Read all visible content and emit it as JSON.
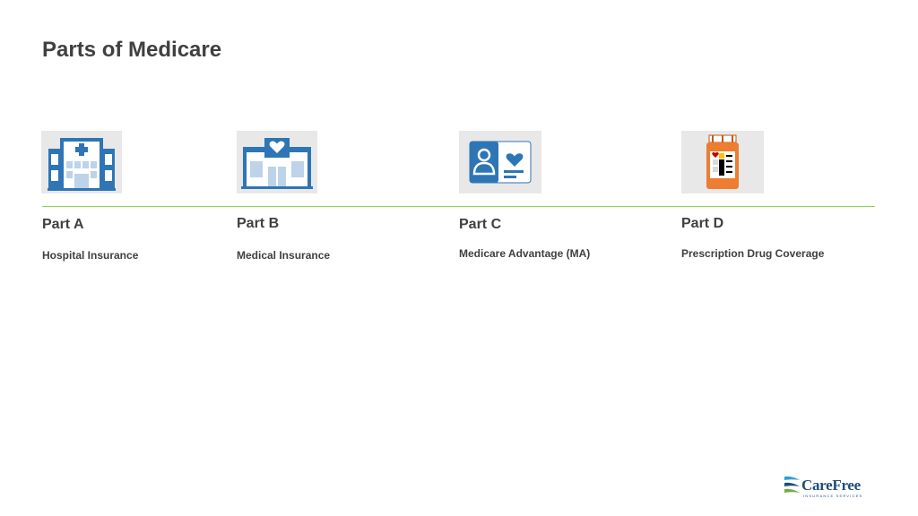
{
  "slide": {
    "title": "Parts of Medicare"
  },
  "parts": [
    {
      "label": "Part A",
      "description": "Hospital Insurance",
      "icon": "hospital-icon"
    },
    {
      "label": "Part B",
      "description": "Medical Insurance",
      "icon": "clinic-icon"
    },
    {
      "label": "Part C",
      "description": "Medicare Advantage (MA)",
      "icon": "member-card-icon"
    },
    {
      "label": "Part D",
      "description": "Prescription Drug Coverage",
      "icon": "pill-bottle-icon"
    }
  ],
  "logo": {
    "word_care": "Care",
    "word_free": "Free",
    "subtitle": "INSURANCE SERVICES",
    "icon": "carefree-wave-icon"
  },
  "colors": {
    "divider": "#92d050",
    "icon_blue": "#2e75b6",
    "icon_bg": "#e8e8e8",
    "bottle_orange": "#ed7d31",
    "text": "#404040"
  }
}
